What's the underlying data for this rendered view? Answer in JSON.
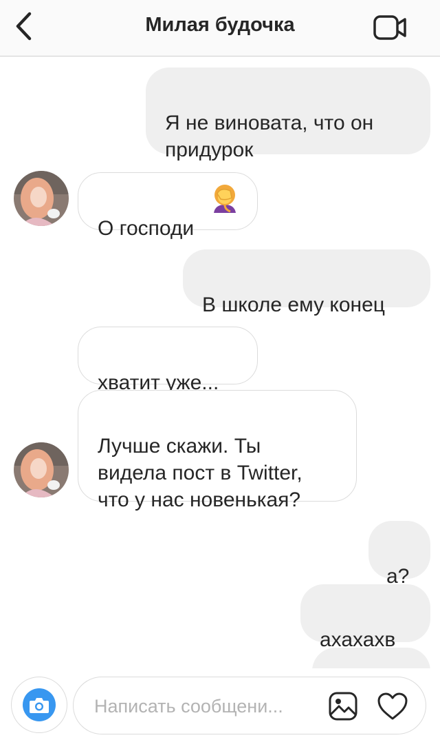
{
  "header": {
    "title": "Милая будочка",
    "back_icon": "chevron-left-icon",
    "video_icon": "video-camera-icon"
  },
  "messages": [
    {
      "direction": "outgoing",
      "text": "Я не виновата, что он\nпридурок"
    },
    {
      "direction": "incoming",
      "text": "О господи"
    },
    {
      "direction": "outgoing",
      "text": "В школе ему конец"
    },
    {
      "direction": "incoming",
      "text": "хватит уже..."
    },
    {
      "direction": "incoming",
      "text": "Лучше скажи. Ты\nвидела пост в Twitter,\nчто у нас новенькая?"
    },
    {
      "direction": "outgoing",
      "text": "а?"
    },
    {
      "direction": "outgoing",
      "text": "ахахахв"
    }
  ],
  "emoji": "face-palm-emoji",
  "composer": {
    "placeholder": "Написать сообщени...",
    "camera_icon": "camera-icon",
    "photo_icon": "image-icon",
    "like_icon": "heart-icon"
  },
  "colors": {
    "accent": "#3897f0",
    "outgoing_bubble": "#efefef",
    "incoming_border": "#dbdbdb",
    "text": "#262626",
    "placeholder": "#b3b3b3"
  }
}
